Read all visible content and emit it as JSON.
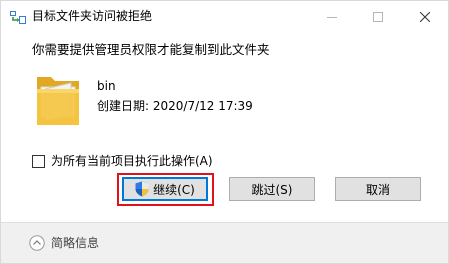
{
  "window": {
    "title": "目标文件夹访问被拒绝"
  },
  "message": "你需要提供管理员权限才能复制到此文件夹",
  "file": {
    "name": "bin",
    "created": "创建日期: 2020/7/12 17:39"
  },
  "checkbox": {
    "label": "为所有当前项目执行此操作(A)",
    "checked": false
  },
  "buttons": {
    "continue": "继续(C)",
    "skip": "跳过(S)",
    "cancel": "取消"
  },
  "footer": {
    "label": "简略信息"
  },
  "colors": {
    "highlight": "#e0121b",
    "accent": "#0078d7",
    "folder": "#f5c542"
  },
  "icons": {
    "app": "copy-arrow-icon",
    "minimize": "minimize-icon",
    "maximize": "maximize-icon",
    "close": "close-icon",
    "folder": "folder-icon",
    "shield": "uac-shield-icon",
    "chevron": "chevron-up-circle-icon"
  }
}
